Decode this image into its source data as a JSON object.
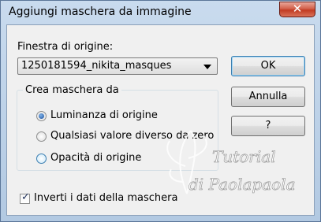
{
  "window": {
    "title": "Aggiungi maschera da immagine",
    "close_glyph": "✕"
  },
  "source": {
    "label": "Finestra di origine:",
    "selected": "1250181594_nikita_masques"
  },
  "buttons": {
    "ok": "OK",
    "cancel": "Annulla",
    "help": "?"
  },
  "mask_group": {
    "label": "Crea maschera da",
    "options": [
      {
        "label": "Luminanza di origine",
        "checked": true
      },
      {
        "label": "Qualsiasi valore diverso da zero",
        "checked": false
      },
      {
        "label": "Opacità di origine",
        "checked": false
      }
    ]
  },
  "invert": {
    "label": "Inverti i dati della maschera",
    "checked": true
  },
  "watermark": {
    "line1": "Tutorial",
    "line2": "di Paolapaola"
  },
  "colors": {
    "accent": "#3c7fb1",
    "close": "#c23b22",
    "titlebar": "#b9cfe7"
  }
}
